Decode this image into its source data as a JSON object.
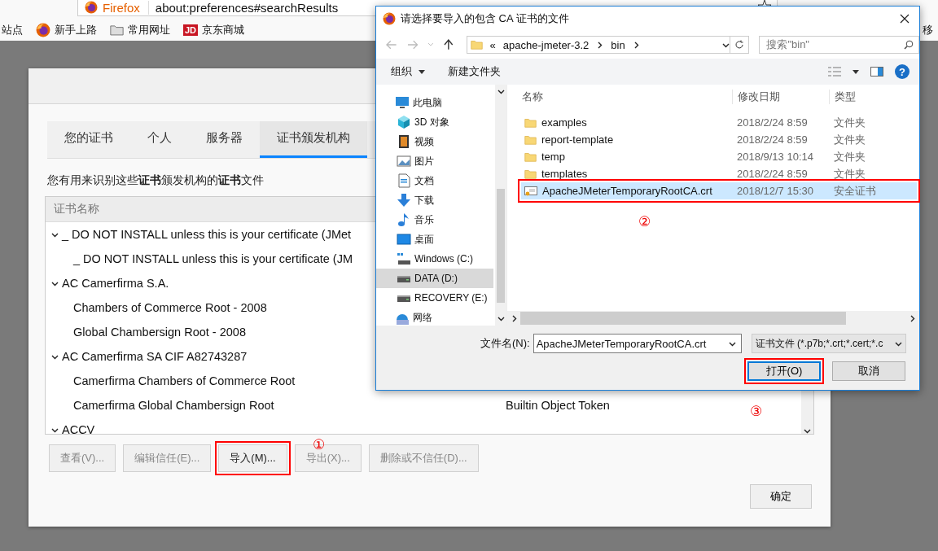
{
  "browser": {
    "app_label": "Firefox",
    "url": "about:preferences#searchResults",
    "bookmarks": [
      {
        "kind": "plain",
        "label": "站点"
      },
      {
        "kind": "firefox",
        "label": "新手上路"
      },
      {
        "kind": "folder",
        "label": "常用网址"
      },
      {
        "kind": "jd",
        "badge": "JD",
        "label": "京东商城"
      },
      {
        "kind": "plain",
        "label": "移"
      }
    ]
  },
  "cert_manager": {
    "tabs": [
      {
        "label": "您的证书",
        "selected": false
      },
      {
        "label": "个人",
        "selected": false
      },
      {
        "label": "服务器",
        "selected": false
      },
      {
        "label": "证书颁发机构",
        "selected": true
      }
    ],
    "description": "您有用来识别这些**证书**颁发机构的**证书**文件",
    "tree": {
      "columns": [
        "证书名称"
      ],
      "rows": [
        {
          "label": "_ DO NOT INSTALL unless this is your certificate (JMet",
          "expanded": true,
          "children": [
            {
              "label": "_ DO NOT INSTALL unless this is your certificate (JM"
            }
          ]
        },
        {
          "label": "AC Camerfirma S.A.",
          "expanded": true,
          "children": [
            {
              "label": "Chambers of Commerce Root - 2008"
            },
            {
              "label": "Global Chambersign Root - 2008"
            }
          ]
        },
        {
          "label": "AC Camerfirma SA CIF A82743287",
          "expanded": true,
          "children": [
            {
              "label": "Camerfirma Chambers of Commerce Root"
            },
            {
              "label": "Camerfirma Global Chambersign Root",
              "token": "Builtin Object Token"
            }
          ]
        },
        {
          "label": "ACCV",
          "expanded": true
        }
      ]
    },
    "buttons": [
      {
        "label": "查看(V)...",
        "disabled": true,
        "highlighted": false
      },
      {
        "label": "编辑信任(E)...",
        "disabled": true,
        "highlighted": false
      },
      {
        "label": "导入(M)...",
        "disabled": false,
        "highlighted": true
      },
      {
        "label": "导出(X)...",
        "disabled": true,
        "highlighted": false
      },
      {
        "label": "删除或不信任(D)...",
        "disabled": true,
        "highlighted": false
      }
    ],
    "ok_button": "确定"
  },
  "file_dialog": {
    "title": "请选择要导入的包含 CA 证书的文件",
    "path_overflow": "«",
    "breadcrumb": [
      "apache-jmeter-3.2",
      "bin"
    ],
    "search": {
      "placeholder": "搜索\"bin\""
    },
    "toolbar": {
      "organize": "组织",
      "new_folder": "新建文件夹",
      "help": "?"
    },
    "nav": [
      {
        "kind": "computer",
        "label": "此电脑",
        "selected": false,
        "children": [
          {
            "kind": "cube",
            "label": "3D 对象",
            "selected": false
          },
          {
            "kind": "video",
            "label": "视频",
            "selected": false
          },
          {
            "kind": "image",
            "label": "图片",
            "selected": false
          },
          {
            "kind": "document",
            "label": "文档",
            "selected": false
          },
          {
            "kind": "download",
            "label": "下载",
            "selected": false
          },
          {
            "kind": "music",
            "label": "音乐",
            "selected": false
          },
          {
            "kind": "desktop",
            "label": "桌面",
            "selected": false
          },
          {
            "kind": "system-drive",
            "label": "Windows (C:)",
            "selected": false
          },
          {
            "kind": "drive",
            "label": "DATA (D:)",
            "selected": true
          },
          {
            "kind": "drive",
            "label": "RECOVERY (E:)",
            "selected": false
          }
        ]
      },
      {
        "kind": "network",
        "label": "网络",
        "selected": false
      }
    ],
    "columns": [
      "名称",
      "修改日期",
      "类型"
    ],
    "files": [
      {
        "kind": "folder",
        "name": "examples",
        "date": "2018/2/24 8:59",
        "type": "文件夹",
        "selected": false,
        "highlighted": false
      },
      {
        "kind": "folder",
        "name": "report-template",
        "date": "2018/2/24 8:59",
        "type": "文件夹",
        "selected": false,
        "highlighted": false
      },
      {
        "kind": "folder",
        "name": "temp",
        "date": "2018/9/13 10:14",
        "type": "文件夹",
        "selected": false,
        "highlighted": false
      },
      {
        "kind": "folder",
        "name": "templates",
        "date": "2018/2/24 8:59",
        "type": "文件夹",
        "selected": false,
        "highlighted": false
      },
      {
        "kind": "certificate",
        "name": "ApacheJMeterTemporaryRootCA.crt",
        "date": "2018/12/7 15:30",
        "type": "安全证书",
        "selected": true,
        "highlighted": true
      }
    ],
    "filename_label": "文件名(N):",
    "filename": "ApacheJMeterTemporaryRootCA.crt",
    "filter": "证书文件 (*.p7b;*.crt;*.cert;*.c",
    "open_button": {
      "label": "打开(O)",
      "highlighted": true
    },
    "cancel_button": {
      "label": "取消",
      "highlighted": false
    }
  },
  "callouts": [
    "①",
    "②",
    "③"
  ]
}
